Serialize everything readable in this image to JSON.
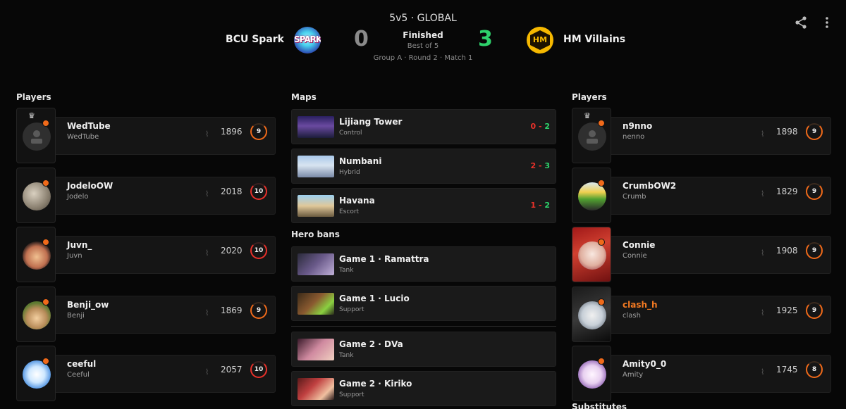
{
  "header": {
    "mode": "5v5 · GLOBAL",
    "status": "Finished",
    "best_of": "Best of 5",
    "stage": "Group A · Round 2 · Match 1",
    "team_a": {
      "name": "BCU Spark",
      "score": "0",
      "logo_text": "SPARK"
    },
    "team_b": {
      "name": "HM Villains",
      "score": "3",
      "logo_text": "HM"
    },
    "share_icon": "share-icon",
    "more_icon": "more-vertical-icon"
  },
  "sections": {
    "players_left": "Players",
    "maps": "Maps",
    "hero_bans": "Hero bans",
    "players_right": "Players",
    "substitutes": "Substitutes"
  },
  "team_a_players": [
    {
      "name": "WedTube",
      "sub": "WedTube",
      "rating": "1896",
      "level": "9",
      "captain": true
    },
    {
      "name": "JodeloOW",
      "sub": "Jodelo",
      "rating": "2018",
      "level": "10"
    },
    {
      "name": "Juvn_",
      "sub": "Juvn",
      "rating": "2020",
      "level": "10"
    },
    {
      "name": "Benji_ow",
      "sub": "Benji",
      "rating": "1869",
      "level": "9"
    },
    {
      "name": "ceeful",
      "sub": "Ceeful",
      "rating": "2057",
      "level": "10"
    }
  ],
  "team_b_players": [
    {
      "name": "n9nno",
      "sub": "nenno",
      "rating": "1898",
      "level": "9",
      "captain": true
    },
    {
      "name": "CrumbOW2",
      "sub": "Crumb",
      "rating": "1829",
      "level": "9"
    },
    {
      "name": "Connie",
      "sub": "Connie",
      "rating": "1908",
      "level": "9"
    },
    {
      "name": "clash_h",
      "sub": "clash",
      "rating": "1925",
      "level": "9"
    },
    {
      "name": "Amity0_0",
      "sub": "Amity",
      "rating": "1745",
      "level": "8"
    }
  ],
  "maps": [
    {
      "name": "Lijiang Tower",
      "mode": "Control",
      "score_a": "0",
      "score_b": "2",
      "sep": " - "
    },
    {
      "name": "Numbani",
      "mode": "Hybrid",
      "score_a": "2",
      "score_b": "3",
      "sep": " - "
    },
    {
      "name": "Havana",
      "mode": "Escort",
      "score_a": "1",
      "score_b": "2",
      "sep": " - "
    }
  ],
  "bans": [
    {
      "title": "Game 1 · Ramattra",
      "role": "Tank"
    },
    {
      "title": "Game 1 · Lucio",
      "role": "Support"
    },
    {
      "title": "Game 2 · DVa",
      "role": "Tank"
    },
    {
      "title": "Game 2 · Kiriko",
      "role": "Support"
    }
  ],
  "colors": {
    "background": "#070707",
    "card": "#151515",
    "win": "#2ed16b",
    "loss": "#e8312a",
    "accent": "#f06a1a"
  }
}
